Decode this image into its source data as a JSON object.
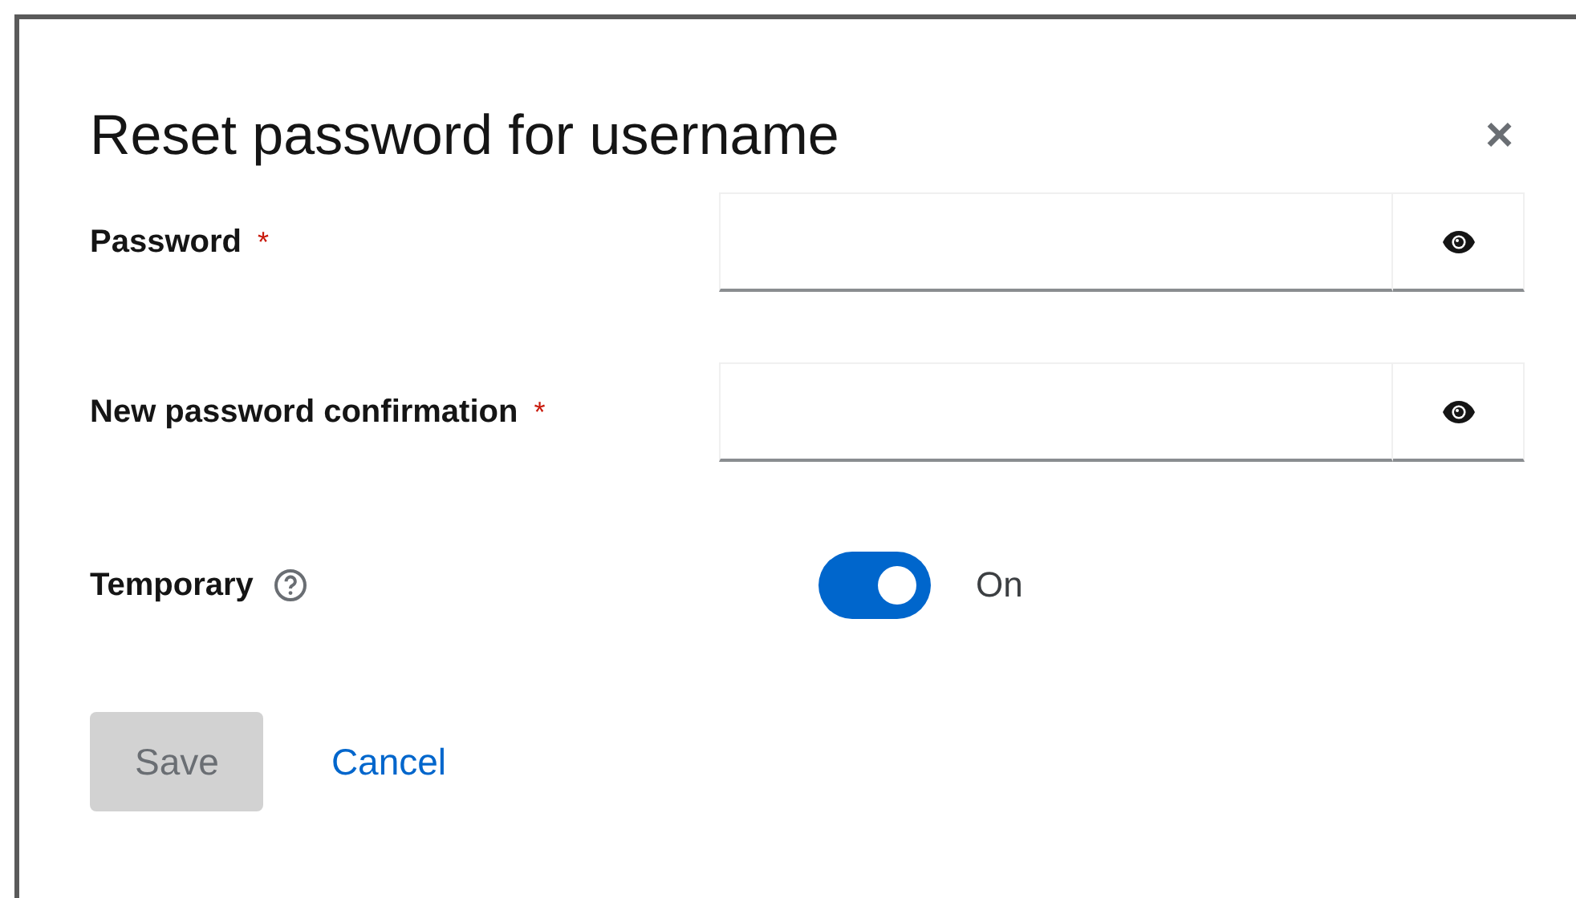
{
  "dialog": {
    "title": "Reset password for username",
    "close": "×"
  },
  "fields": [
    {
      "label": "Password",
      "required": true,
      "required_mark": "*"
    },
    {
      "label": "New password confirmation",
      "required": true,
      "required_mark": "*"
    }
  ],
  "temporary": {
    "label": "Temporary",
    "on": true,
    "state_label": "On"
  },
  "buttons": [
    {
      "kind": "primary",
      "label": "Save",
      "disabled": true
    },
    {
      "kind": "link",
      "label": "Cancel",
      "disabled": false
    }
  ]
}
